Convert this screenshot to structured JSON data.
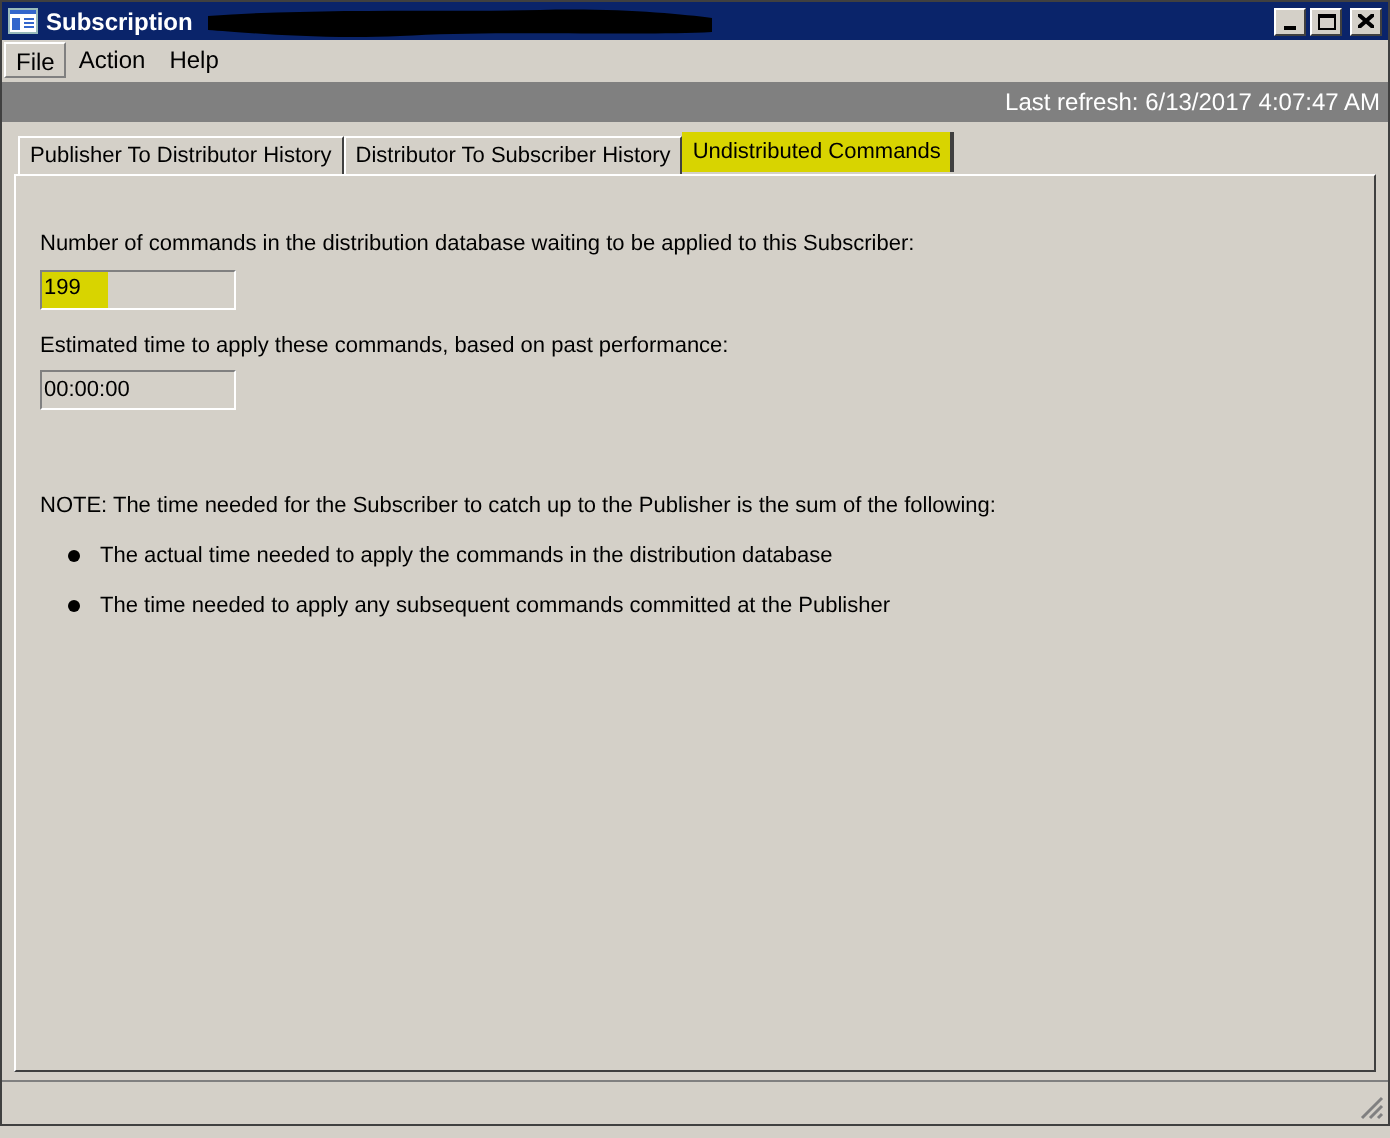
{
  "window": {
    "title": "Subscription"
  },
  "menu": [
    {
      "label": "File",
      "selected": true
    },
    {
      "label": "Action",
      "selected": false
    },
    {
      "label": "Help",
      "selected": false
    }
  ],
  "refresh": "Last refresh: 6/13/2017 4:07:47 AM",
  "tabs": [
    {
      "label": "Publisher To Distributor History",
      "selected": false
    },
    {
      "label": "Distributor To Subscriber History",
      "selected": false
    },
    {
      "label": "Undistributed Commands",
      "selected": true
    }
  ],
  "fields": [
    {
      "label": "Number of commands in the distribution database waiting to be applied to this Subscriber:",
      "value": "199",
      "highlighted": true
    },
    {
      "label": "Estimated time to apply these commands, based on past performance:",
      "value": "00:00:00",
      "highlighted": false
    }
  ],
  "note": "NOTE: The time needed for the Subscriber to catch up to the Publisher is the sum of the following:",
  "bullets": [
    "The actual time needed to apply the commands in the distribution database",
    "The time needed to apply any subsequent commands committed at the Publisher"
  ]
}
